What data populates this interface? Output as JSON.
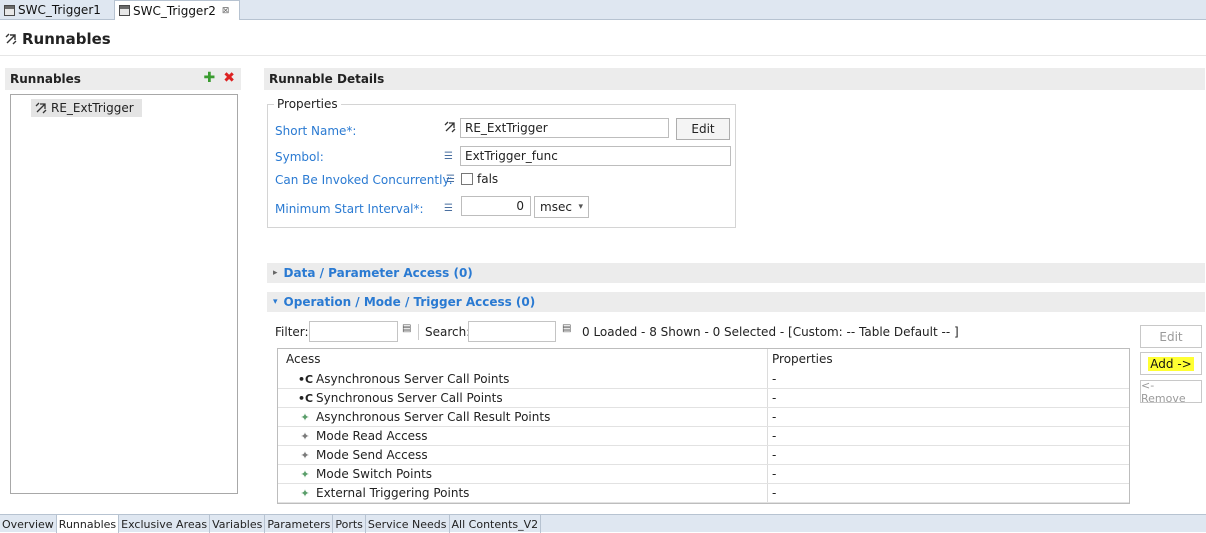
{
  "editor_tabs": [
    {
      "label": "SWC_Trigger1",
      "active": false
    },
    {
      "label": "SWC_Trigger2",
      "active": true,
      "close": "⊠"
    }
  ],
  "page": {
    "title": "Runnables"
  },
  "left_pane": {
    "header": "Runnables",
    "add_icon": "plus-icon",
    "delete_icon": "delete-icon",
    "items": [
      {
        "label": "RE_ExtTrigger"
      }
    ]
  },
  "details": {
    "header": "Runnable Details",
    "properties_group": "Properties",
    "short_name_label": "Short Name*:",
    "short_name_value": "RE_ExtTrigger",
    "edit_button": "Edit",
    "symbol_label": "Symbol:",
    "symbol_value": "ExtTrigger_func",
    "concurrent_label": "Can Be Invoked Concurrently:",
    "concurrent_value": "fals",
    "min_interval_label": "Minimum Start Interval*:",
    "min_interval_value": "0",
    "min_interval_unit": "msec"
  },
  "sections": {
    "data_param": "Data / Parameter Access (0)",
    "operation": "Operation / Mode / Trigger Access (0)"
  },
  "filter": {
    "filter_label": "Filter:",
    "search_label": "Search:",
    "status": "0 Loaded - 8 Shown - 0 Selected -  [Custom: -- Table Default -- ]"
  },
  "table": {
    "columns": [
      "Acess",
      "Properties"
    ],
    "rows": [
      {
        "name": "Asynchronous Server Call Points",
        "props": "-",
        "icon": "dark"
      },
      {
        "name": "Synchronous Server Call Points",
        "props": "-",
        "icon": "dark"
      },
      {
        "name": "Asynchronous Server Call Result Points",
        "props": "-",
        "icon": "green"
      },
      {
        "name": "Mode Read Access",
        "props": "-",
        "icon": "grey"
      },
      {
        "name": "Mode Send Access",
        "props": "-",
        "icon": "grey"
      },
      {
        "name": "Mode Switch Points",
        "props": "-",
        "icon": "green"
      },
      {
        "name": "External Triggering Points",
        "props": "-",
        "icon": "green"
      }
    ]
  },
  "side_buttons": {
    "edit": "Edit",
    "add": "Add ->",
    "remove": "<- Remove"
  },
  "bottom_tabs": [
    {
      "label": "Overview",
      "active": false
    },
    {
      "label": "Runnables",
      "active": true
    },
    {
      "label": "Exclusive Areas",
      "active": false
    },
    {
      "label": "Variables",
      "active": false
    },
    {
      "label": "Parameters",
      "active": false
    },
    {
      "label": "Ports",
      "active": false
    },
    {
      "label": "Service Needs",
      "active": false
    },
    {
      "label": "All Contents_V2",
      "active": false
    }
  ]
}
